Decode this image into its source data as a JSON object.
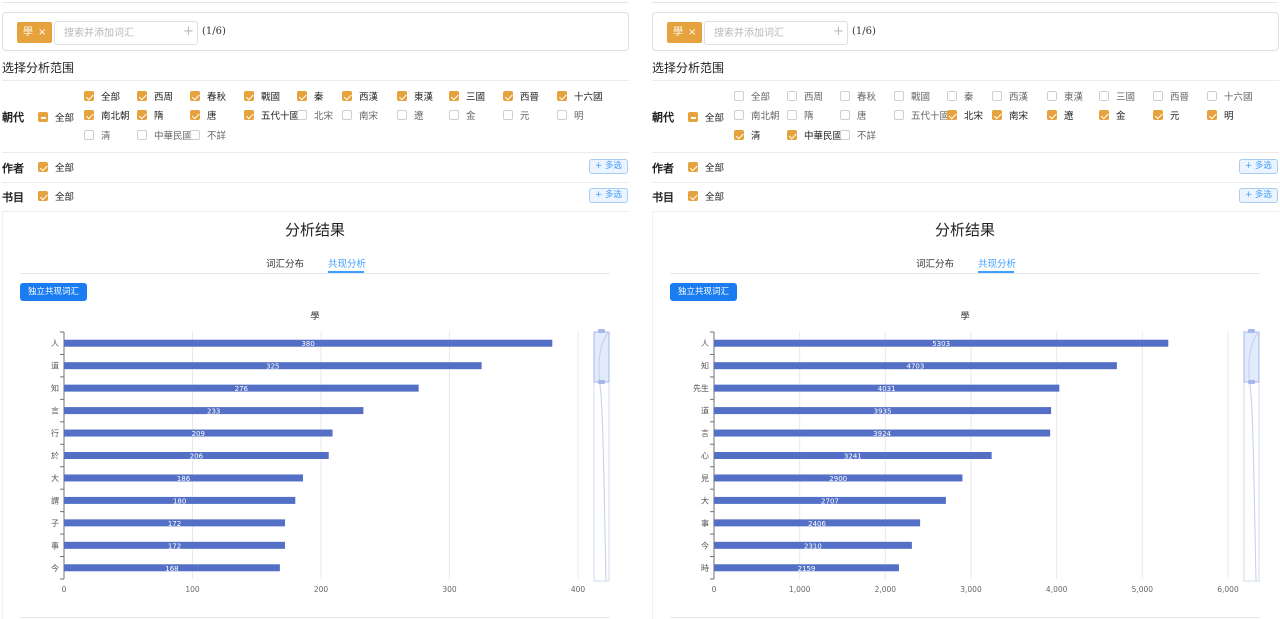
{
  "panels": [
    {
      "search": {
        "tag": "學",
        "tag_close": "×",
        "placeholder": "搜索并添加词汇",
        "count": "(1/6)"
      },
      "scope_title": "选择分析范围",
      "dynasty": {
        "label": "朝代",
        "all_label": "全部",
        "all_state": "indeterminate",
        "options": [
          {
            "label": "全部",
            "checked": true
          },
          {
            "label": "西周",
            "checked": true
          },
          {
            "label": "春秋",
            "checked": true
          },
          {
            "label": "戰國",
            "checked": true
          },
          {
            "label": "秦",
            "checked": true
          },
          {
            "label": "西漢",
            "checked": true
          },
          {
            "label": "東漢",
            "checked": true
          },
          {
            "label": "三國",
            "checked": true
          },
          {
            "label": "西晉",
            "checked": true
          },
          {
            "label": "十六國",
            "checked": true
          },
          {
            "label": "南北朝",
            "checked": true
          },
          {
            "label": "隋",
            "checked": true
          },
          {
            "label": "唐",
            "checked": true
          },
          {
            "label": "五代十國",
            "checked": true
          },
          {
            "label": "北宋",
            "checked": false
          },
          {
            "label": "南宋",
            "checked": false
          },
          {
            "label": "遼",
            "checked": false
          },
          {
            "label": "金",
            "checked": false
          },
          {
            "label": "元",
            "checked": false
          },
          {
            "label": "明",
            "checked": false
          },
          {
            "label": "清",
            "checked": false
          },
          {
            "label": "中華民國",
            "checked": false
          },
          {
            "label": "不詳",
            "checked": false
          }
        ]
      },
      "author": {
        "label": "作者",
        "all_label": "全部",
        "multi_label": "+ 多选"
      },
      "book": {
        "label": "书目",
        "all_label": "全部",
        "multi_label": "+ 多选"
      },
      "result_title": "分析结果",
      "tabs": [
        {
          "label": "词汇分布",
          "active": false
        },
        {
          "label": "共现分析",
          "active": true
        }
      ],
      "action_button": "独立共现词汇",
      "chart_data": {
        "type": "bar",
        "orientation": "horizontal",
        "title": "學",
        "categories": [
          "人",
          "道",
          "知",
          "言",
          "行",
          "於",
          "大",
          "謂",
          "子",
          "事",
          "今"
        ],
        "values": [
          380,
          325,
          276,
          233,
          209,
          206,
          186,
          180,
          172,
          172,
          168
        ],
        "xlim": [
          0,
          400
        ],
        "xticks": [
          "0",
          "100",
          "200",
          "300",
          "400"
        ],
        "bar_color": "#5470c6",
        "grid": true
      }
    },
    {
      "search": {
        "tag": "學",
        "tag_close": "×",
        "placeholder": "搜索并添加词汇",
        "count": "(1/6)"
      },
      "scope_title": "选择分析范围",
      "dynasty": {
        "label": "朝代",
        "all_label": "全部",
        "all_state": "indeterminate",
        "options": [
          {
            "label": "全部",
            "checked": false
          },
          {
            "label": "西周",
            "checked": false
          },
          {
            "label": "春秋",
            "checked": false
          },
          {
            "label": "戰國",
            "checked": false
          },
          {
            "label": "秦",
            "checked": false
          },
          {
            "label": "西漢",
            "checked": false
          },
          {
            "label": "東漢",
            "checked": false
          },
          {
            "label": "三國",
            "checked": false
          },
          {
            "label": "西晉",
            "checked": false
          },
          {
            "label": "十六國",
            "checked": false
          },
          {
            "label": "南北朝",
            "checked": false
          },
          {
            "label": "隋",
            "checked": false
          },
          {
            "label": "唐",
            "checked": false
          },
          {
            "label": "五代十國",
            "checked": false
          },
          {
            "label": "北宋",
            "checked": true
          },
          {
            "label": "南宋",
            "checked": true
          },
          {
            "label": "遼",
            "checked": true
          },
          {
            "label": "金",
            "checked": true
          },
          {
            "label": "元",
            "checked": true
          },
          {
            "label": "明",
            "checked": true
          },
          {
            "label": "清",
            "checked": true
          },
          {
            "label": "中華民國",
            "checked": true
          },
          {
            "label": "不詳",
            "checked": false
          }
        ]
      },
      "author": {
        "label": "作者",
        "all_label": "全部",
        "multi_label": "+ 多选"
      },
      "book": {
        "label": "书目",
        "all_label": "全部",
        "multi_label": "+ 多选"
      },
      "result_title": "分析结果",
      "tabs": [
        {
          "label": "词汇分布",
          "active": false
        },
        {
          "label": "共现分析",
          "active": true
        }
      ],
      "action_button": "独立共现词汇",
      "chart_data": {
        "type": "bar",
        "orientation": "horizontal",
        "title": "學",
        "categories": [
          "人",
          "知",
          "先生",
          "道",
          "言",
          "心",
          "見",
          "大",
          "事",
          "今",
          "時"
        ],
        "values": [
          5303,
          4703,
          4031,
          3935,
          3924,
          3241,
          2900,
          2707,
          2406,
          2310,
          2159
        ],
        "xlim": [
          0,
          6000
        ],
        "xticks": [
          "0",
          "1,000",
          "2,000",
          "3,000",
          "4,000",
          "5,000",
          "6,000"
        ],
        "bar_color": "#5470c6",
        "grid": true
      }
    }
  ]
}
